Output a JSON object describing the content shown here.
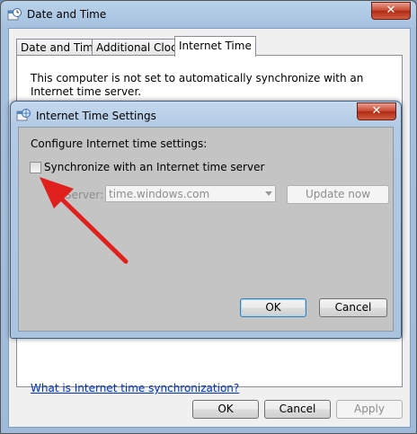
{
  "window": {
    "title": "Date and Time",
    "close_glyph": "✕",
    "tabs": [
      {
        "label": "Date and Time"
      },
      {
        "label": "Additional Clocks"
      },
      {
        "label": "Internet Time"
      }
    ],
    "panel_text": "This computer is not set to automatically synchronize with an Internet time server.",
    "link_text": "What is Internet time synchronization?",
    "buttons": {
      "ok": "OK",
      "cancel": "Cancel",
      "apply": "Apply"
    }
  },
  "dialog": {
    "title": "Internet Time Settings",
    "close_glyph": "✕",
    "configure_label": "Configure Internet time settings:",
    "sync_checkbox_label": "Synchronize with an Internet time server",
    "sync_checked": false,
    "server_label": "Server:",
    "server_value": "time.windows.com",
    "update_now": "Update now",
    "ok": "OK",
    "cancel": "Cancel"
  },
  "colors": {
    "annotation_arrow": "#e0201c",
    "link": "#0033cc"
  },
  "icons": [
    "date-time-app-icon",
    "internet-time-icon",
    "close-icon",
    "dropdown-arrow-icon",
    "red-annotation-arrow"
  ]
}
